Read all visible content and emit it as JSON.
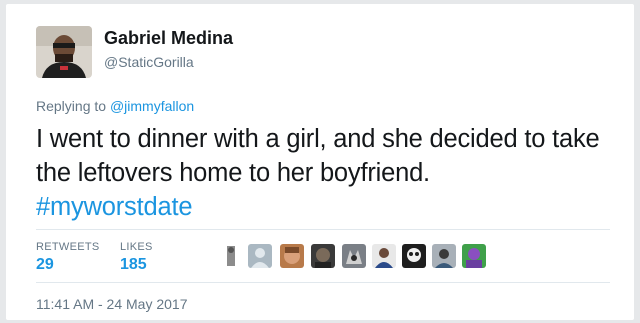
{
  "user": {
    "name": "Gabriel Medina",
    "handle": "@StaticGorilla"
  },
  "reply": {
    "prefix": "Replying to ",
    "mention": "@jimmyfallon"
  },
  "tweet": {
    "text": "I went to dinner with a girl, and she decided to take the leftovers home to her boyfriend.",
    "hashtag": "#myworstdate"
  },
  "stats": {
    "retweets_label": "RETWEETS",
    "retweets_value": "29",
    "likes_label": "LIKES",
    "likes_value": "185"
  },
  "likers": [
    {
      "icon": "liker-avatar-1",
      "color": "#9a9a9a"
    },
    {
      "icon": "default-avatar",
      "color": "#aab8c2"
    },
    {
      "icon": "liker-avatar-3",
      "color": "#c98a5a"
    },
    {
      "icon": "liker-avatar-4",
      "color": "#6b5a4a"
    },
    {
      "icon": "liker-avatar-5",
      "color": "#8a8f96"
    },
    {
      "icon": "liker-avatar-6",
      "color": "#3d5a8a"
    },
    {
      "icon": "liker-avatar-7",
      "color": "#2b2b2b"
    },
    {
      "icon": "liker-avatar-8",
      "color": "#4a6a8a"
    },
    {
      "icon": "liker-avatar-9",
      "color": "#6a3fa0"
    }
  ],
  "timestamp": "11:41 AM - 24 May 2017",
  "colors": {
    "link": "#1b95e0",
    "secondary_text": "#657786",
    "primary_text": "#14171a"
  }
}
